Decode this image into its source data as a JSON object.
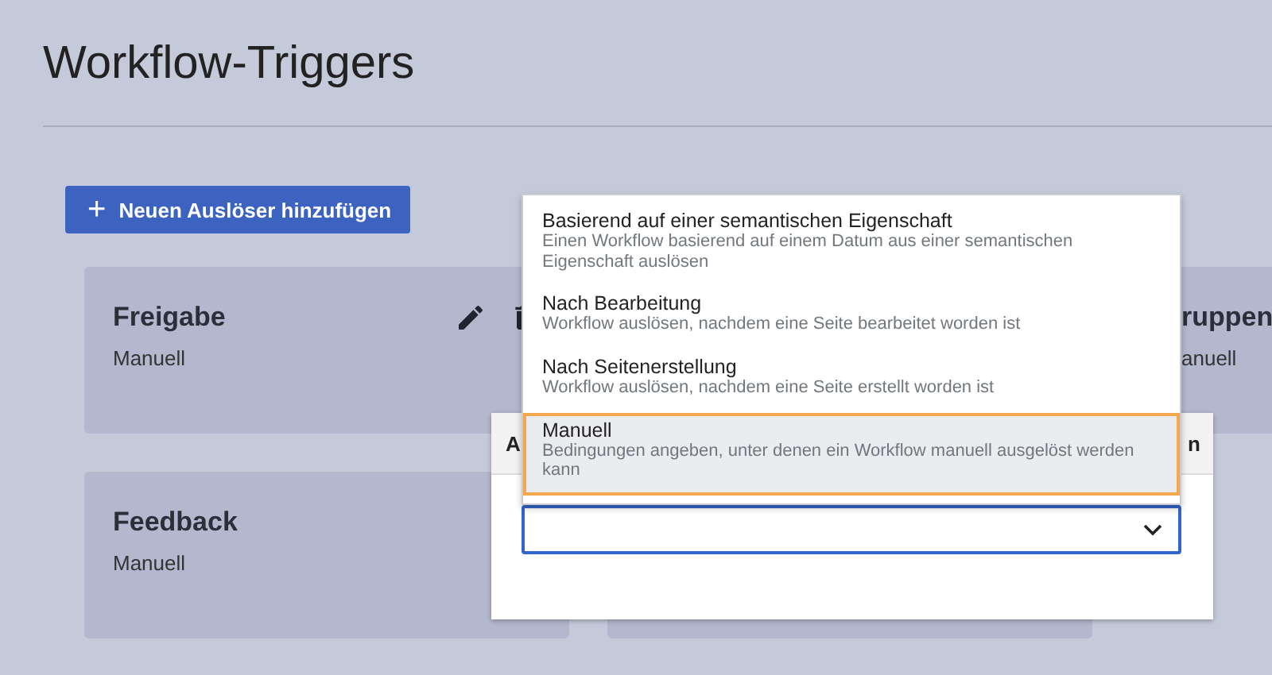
{
  "page": {
    "title": "Workflow-Triggers"
  },
  "add_button": {
    "icon": "+",
    "label": "Neuen Auslöser hinzufügen"
  },
  "cards": [
    {
      "kind": "full",
      "title": "Freigabe",
      "subtitle": "Manuell"
    },
    {
      "kind": "cut",
      "title": "ruppen",
      "subtitle": "anuell"
    },
    {
      "kind": "edit",
      "title": "Feedback",
      "subtitle": "Manuell"
    }
  ],
  "dialog": {
    "header_left": "A",
    "header_right": "n"
  },
  "dropdown_options": [
    {
      "label": "Basierend auf einer semantischen Eigenschaft",
      "description": "Einen Workflow basierend auf einem Datum aus einer semantischen Eigenschaft auslösen",
      "selected": false
    },
    {
      "label": "Nach Bearbeitung",
      "description": "Workflow auslösen, nachdem eine Seite bearbeitet worden ist",
      "selected": false
    },
    {
      "label": "Nach Seitenerstellung",
      "description": "Workflow auslösen, nachdem eine Seite erstellt worden ist",
      "selected": false
    },
    {
      "label": "Manuell",
      "description": "Bedingungen angeben, unter denen ein Workflow manuell ausgelöst werden kann",
      "selected": true
    }
  ]
}
